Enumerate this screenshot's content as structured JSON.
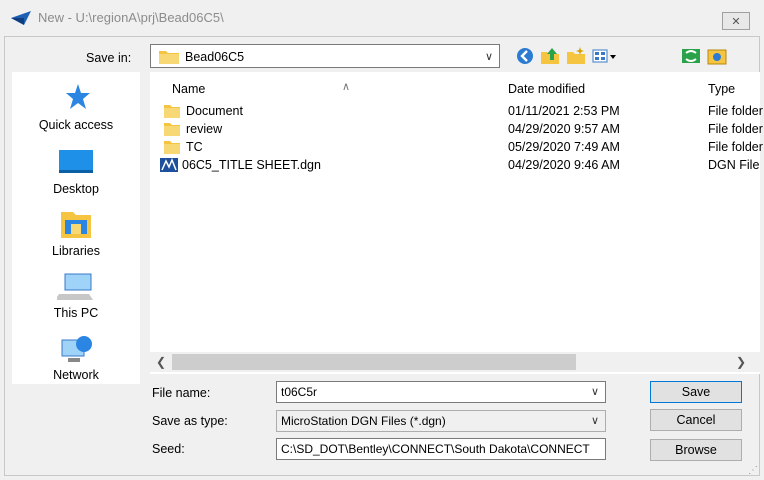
{
  "window": {
    "title": "New - U:\\regionA\\prj\\Bead06C5\\",
    "close_glyph": "✕"
  },
  "save_in": {
    "label": "Save in:",
    "value": "Bead06C5"
  },
  "places": [
    {
      "label": "Quick access",
      "icon": "star-icon"
    },
    {
      "label": "Desktop",
      "icon": "desktop-icon"
    },
    {
      "label": "Libraries",
      "icon": "libraries-icon"
    },
    {
      "label": "This PC",
      "icon": "computer-icon"
    },
    {
      "label": "Network",
      "icon": "network-icon"
    }
  ],
  "columns": {
    "name": "Name",
    "date": "Date modified",
    "type": "Type"
  },
  "files": [
    {
      "name": "Document",
      "date": "01/11/2021 2:53 PM",
      "type": "File folder",
      "icon": "folder-icon"
    },
    {
      "name": "review",
      "date": "04/29/2020 9:57 AM",
      "type": "File folder",
      "icon": "folder-icon"
    },
    {
      "name": "TC",
      "date": "05/29/2020 7:49 AM",
      "type": "File folder",
      "icon": "folder-icon"
    },
    {
      "name": "06C5_TITLE SHEET.dgn",
      "date": "04/29/2020 9:46 AM",
      "type": "DGN File",
      "icon": "dgn-file-icon"
    }
  ],
  "form": {
    "file_name_label": "File name:",
    "file_name_value": "t06C5r",
    "save_as_type_label": "Save as type:",
    "save_as_type_value": "MicroStation DGN Files (*.dgn)",
    "seed_label": "Seed:",
    "seed_value": "C:\\SD_DOT\\Bentley\\CONNECT\\South Dakota\\CONNECT"
  },
  "buttons": {
    "save": "Save",
    "cancel": "Cancel",
    "browse": "Browse"
  },
  "colors": {
    "folder": "#f5c542",
    "accent": "#0078d7",
    "selection_border": "#0078d7"
  }
}
